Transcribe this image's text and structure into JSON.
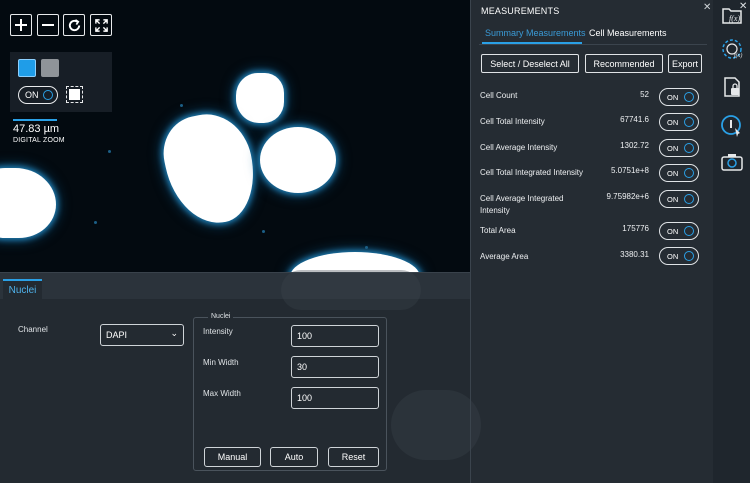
{
  "viewer": {
    "toolbar": [
      {
        "name": "zoom-in-icon",
        "glyph": "+"
      },
      {
        "name": "zoom-out-icon",
        "glyph": "−"
      },
      {
        "name": "reset-view-icon",
        "glyph": "↻"
      },
      {
        "name": "fit-to-screen-icon",
        "glyph": "⤢"
      }
    ],
    "channel_toggle_label": "ON",
    "scale_value": "47.83 µm",
    "scale_caption": "DIGITAL ZOOM",
    "colors": {
      "swatch_blue": "#1f9de8",
      "swatch_gray": "#8f9499",
      "glow": "#1e7bb0"
    }
  },
  "bottom_panel": {
    "tab_label": "Nuclei",
    "channel_label": "Channel",
    "channel_value": "DAPI",
    "group_title": "Nuclei",
    "fields": [
      {
        "label": "Intensity",
        "value": "100"
      },
      {
        "label": "Min Width",
        "value": "30"
      },
      {
        "label": "Max Width",
        "value": "100"
      }
    ],
    "buttons": {
      "manual": "Manual",
      "auto": "Auto",
      "reset": "Reset"
    }
  },
  "measurements": {
    "title": "MEASUREMENTS",
    "tabs": {
      "summary": "Summary Measurements",
      "cell": "Cell Measurements"
    },
    "buttons": {
      "select_all": "Select / Deselect All",
      "recommended": "Recommended",
      "export": "Export"
    },
    "toggle_label": "ON",
    "rows": [
      {
        "label": "Cell Count",
        "value": "52"
      },
      {
        "label": "Cell Total Intensity",
        "value": "67741.6"
      },
      {
        "label": "Cell Average Intensity",
        "value": "1302.72"
      },
      {
        "label": "Cell Total Integrated Intensity",
        "value": "5.0751e+8"
      },
      {
        "label": "Cell Average Integrated Intensity",
        "value": "9.75982e+6"
      },
      {
        "label": "Total Area",
        "value": "175776"
      },
      {
        "label": "Average Area",
        "value": "3380.31"
      }
    ]
  },
  "rail": {
    "icons": [
      "function-folder-icon",
      "function-gear-icon",
      "locked-document-icon",
      "info-cursor-icon",
      "camera-icon"
    ]
  }
}
